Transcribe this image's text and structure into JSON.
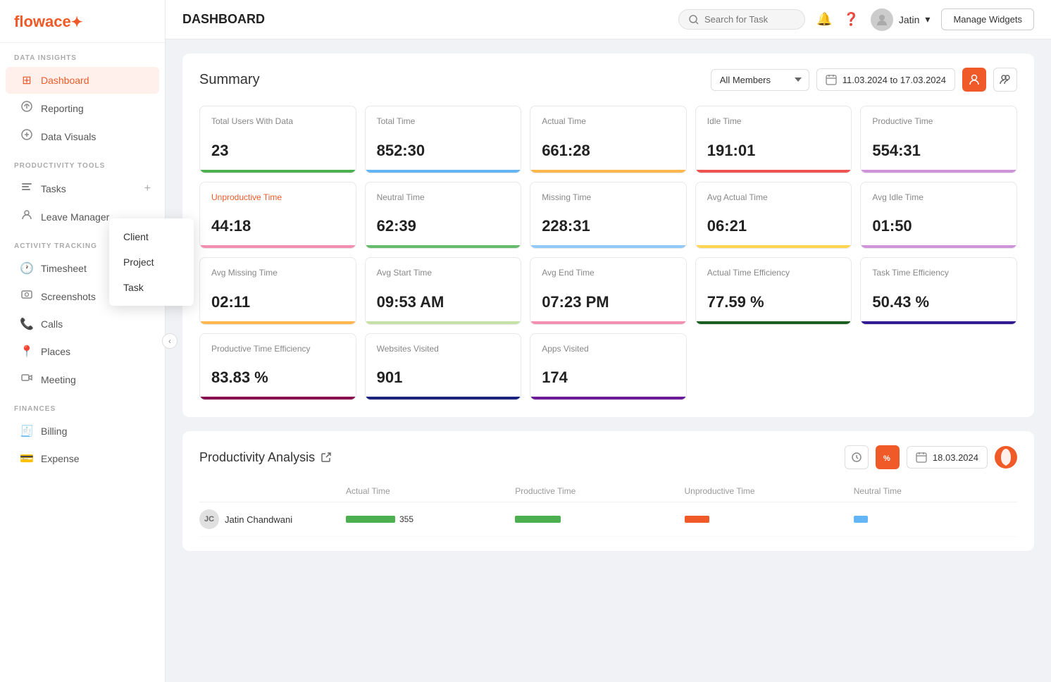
{
  "logo": {
    "flow": "flow",
    "ace": "ace",
    "flame": "🔥"
  },
  "sidebar": {
    "data_insights_label": "DATA INSIGHTS",
    "productivity_tools_label": "PRODUCTIVITY TOOLS",
    "activity_tracking_label": "ACTIVITY TRACKING",
    "finances_label": "FINANCES",
    "items_data_insights": [
      {
        "id": "dashboard",
        "label": "Dashboard",
        "icon": "⊞",
        "active": true
      },
      {
        "id": "reporting",
        "label": "Reporting",
        "icon": "📊",
        "active": false
      },
      {
        "id": "data-visuals",
        "label": "Data Visuals",
        "icon": "🔄",
        "active": false
      }
    ],
    "items_productivity": [
      {
        "id": "tasks",
        "label": "Tasks",
        "icon": "✅",
        "active": false,
        "plus": true
      },
      {
        "id": "leave-manager",
        "label": "Leave Manager",
        "icon": "👤",
        "active": false
      }
    ],
    "items_activity": [
      {
        "id": "timesheet",
        "label": "Timesheet",
        "icon": "🕐",
        "active": false
      },
      {
        "id": "screenshots",
        "label": "Screenshots",
        "icon": "📷",
        "active": false
      },
      {
        "id": "calls",
        "label": "Calls",
        "icon": "📞",
        "active": false
      },
      {
        "id": "places",
        "label": "Places",
        "icon": "📍",
        "active": false
      },
      {
        "id": "meeting",
        "label": "Meeting",
        "icon": "👥",
        "active": false
      }
    ],
    "items_finances": [
      {
        "id": "billing",
        "label": "Billing",
        "icon": "🧾",
        "active": false
      },
      {
        "id": "expense",
        "label": "Expense",
        "icon": "💳",
        "active": false
      }
    ],
    "tasks_dropdown": [
      "Client",
      "Project",
      "Task"
    ]
  },
  "header": {
    "search_placeholder": "Search for Task",
    "manage_widgets_label": "Manage Widgets",
    "user_name": "Jatin",
    "page_title": "DASHBOARD"
  },
  "summary": {
    "title": "Summary",
    "members_dropdown": "All Members",
    "date_range": "11.03.2024 to 17.03.2024",
    "stats_row1": [
      {
        "label": "Total Users With Data",
        "value": "23",
        "bar_color": "#4caf50",
        "label_color": "normal"
      },
      {
        "label": "Total Time",
        "value": "852:30",
        "bar_color": "#64b5f6",
        "label_color": "normal"
      },
      {
        "label": "Actual Time",
        "value": "661:28",
        "bar_color": "#ffb74d",
        "label_color": "normal"
      },
      {
        "label": "Idle Time",
        "value": "191:01",
        "bar_color": "#ef5350",
        "label_color": "normal"
      },
      {
        "label": "Productive Time",
        "value": "554:31",
        "bar_color": "#ce93d8",
        "label_color": "normal"
      }
    ],
    "stats_row2": [
      {
        "label": "Unproductive Time",
        "value": "44:18",
        "bar_color": "#f48fb1",
        "label_color": "orange"
      },
      {
        "label": "Neutral Time",
        "value": "62:39",
        "bar_color": "#66bb6a",
        "label_color": "normal"
      },
      {
        "label": "Missing Time",
        "value": "228:31",
        "bar_color": "#90caf9",
        "label_color": "normal"
      },
      {
        "label": "Avg Actual Time",
        "value": "06:21",
        "bar_color": "#ffd54f",
        "label_color": "normal"
      },
      {
        "label": "Avg Idle Time",
        "value": "01:50",
        "bar_color": "#ce93d8",
        "label_color": "normal"
      }
    ],
    "stats_row3": [
      {
        "label": "Avg Missing Time",
        "value": "02:11",
        "bar_color": "#ffb74d",
        "label_color": "normal"
      },
      {
        "label": "Avg Start Time",
        "value": "09:53 AM",
        "bar_color": "#c5e1a5",
        "label_color": "normal"
      },
      {
        "label": "Avg End Time",
        "value": "07:23 PM",
        "bar_color": "#f48fb1",
        "label_color": "normal"
      },
      {
        "label": "Actual Time Efficiency",
        "value": "77.59 %",
        "bar_color": "#1b5e20",
        "label_color": "normal"
      },
      {
        "label": "Task Time Efficiency",
        "value": "50.43 %",
        "bar_color": "#311b92",
        "label_color": "normal"
      }
    ],
    "stats_row4": [
      {
        "label": "Productive Time Efficiency",
        "value": "83.83 %",
        "bar_color": "#880e4f",
        "label_color": "normal"
      },
      {
        "label": "Websites Visited",
        "value": "901",
        "bar_color": "#1a237e",
        "label_color": "normal"
      },
      {
        "label": "Apps Visited",
        "value": "174",
        "bar_color": "#6a1b9a",
        "label_color": "normal"
      }
    ]
  },
  "productivity_analysis": {
    "title": "Productivity Analysis",
    "date": "18.03.2024",
    "table_headers": [
      "",
      "Actual Time",
      "Productive Time",
      "Unproductive Time",
      "Neutral Time"
    ],
    "table_row": {
      "user": "Jatin Chandwani",
      "initials": "JC",
      "actual_time": "355",
      "actual_bar_color": "#4caf50",
      "productive_bar": 65,
      "productive_color": "#4caf50",
      "unproductive_bar": 35,
      "unproductive_color": "#f05a28",
      "neutral_bar": 20,
      "neutral_color": "#64b5f6"
    }
  }
}
